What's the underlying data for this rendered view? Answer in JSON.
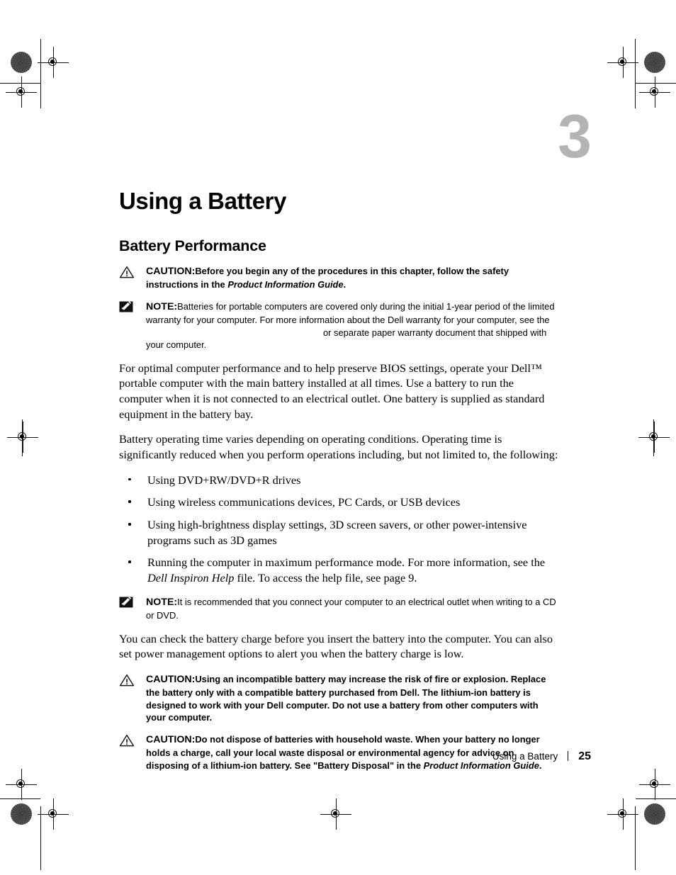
{
  "page": {
    "chapter_number": "3",
    "chapter_title": "Using a Battery",
    "section_title": "Battery Performance"
  },
  "admonitions": {
    "caution1": {
      "icon": "warning-triangle-icon",
      "label": "CAUTION:",
      "text": "Before you begin any of the procedures in this chapter, follow the safety instructions in the ",
      "italic_ref": "Product Information Guide",
      "text_end": "."
    },
    "note1": {
      "icon": "note-pencil-icon",
      "label": "NOTE:",
      "text": "Batteries for portable computers are covered only during the initial 1-year period of the limited warranty for your computer. For more information about the Dell warranty for your computer, see the",
      "text_end": "or separate paper warranty document that shipped with your computer."
    },
    "note2": {
      "icon": "note-pencil-icon",
      "label": "NOTE:",
      "text": "It is recommended that you connect your computer to an electrical outlet when writing to a CD or DVD."
    },
    "caution2": {
      "icon": "warning-triangle-icon",
      "label": "CAUTION:",
      "text": "Using an incompatible battery may increase the risk of fire or explosion. Replace the battery only with a compatible battery purchased from Dell. The lithium-ion battery is designed to work with your Dell computer. Do not use a battery from other computers with your computer."
    },
    "caution3": {
      "icon": "warning-triangle-icon",
      "label": "CAUTION:",
      "text": "Do not dispose of batteries with household waste. When your battery no longer holds a charge, call your local waste disposal or environmental agency for advice on disposing of a lithium-ion battery. See \"Battery Disposal\" in the ",
      "italic_ref": "Product Information Guide",
      "text_end": "."
    }
  },
  "paragraphs": {
    "p1": "For optimal computer performance and to help preserve BIOS settings, operate your Dell™ portable computer with the main battery installed at all times. Use a battery to run the computer when it is not connected to an electrical outlet. One battery is supplied as standard equipment in the battery bay.",
    "p2": "Battery operating time varies depending on operating conditions. Operating time is significantly reduced when you perform operations including, but not limited to, the following:",
    "p3": "You can check the battery charge before you insert the battery into the computer. You can also set power management options to alert you when the battery charge is low."
  },
  "bullets": [
    {
      "text": "Using DVD+RW/DVD+R drives"
    },
    {
      "text": "Using wireless communications devices, PC Cards, or USB devices"
    },
    {
      "text": "Using high-brightness display settings, 3D screen savers, or other power-intensive programs such as 3D games"
    },
    {
      "text_before": "Running the computer in maximum performance mode. For more information, see the ",
      "italic": "Dell Inspiron Help",
      "text_after": " file. To access the help file, see page 9."
    }
  ],
  "footer": {
    "chapter_label": "Using a Battery",
    "page_number": "25"
  },
  "colors": {
    "chapter_number": "#b4b4b4",
    "text": "#000000",
    "background": "#ffffff"
  }
}
